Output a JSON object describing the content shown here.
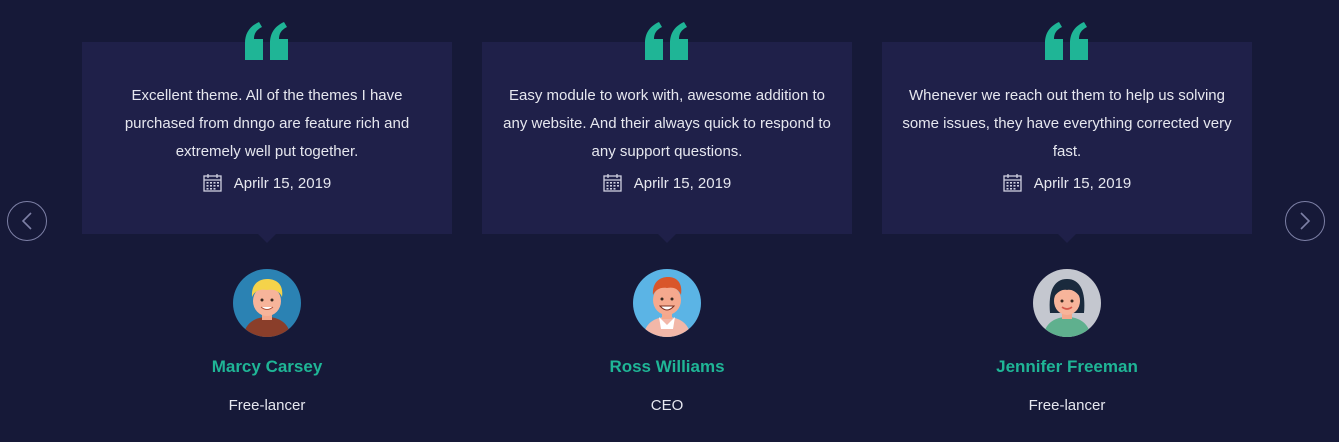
{
  "colors": {
    "background": "#161938",
    "card": "#1f2049",
    "accent": "#1fb596",
    "text": "#e6e7ef"
  },
  "navigation": {
    "prev_icon": "chevron-left-icon",
    "next_icon": "chevron-right-icon"
  },
  "testimonials": [
    {
      "quote": "Excellent theme. All of the themes I have purchased from dnngo are feature rich and extremely well put together.",
      "date": "Aprilr 15, 2019",
      "name": "Marcy Carsey",
      "role": "Free-lancer",
      "avatar": "avatar-blond-man"
    },
    {
      "quote": "Easy module to work with, awesome addition to any website. And their always quick to respond to any support questions.",
      "date": "Aprilr 15, 2019",
      "name": "Ross Williams",
      "role": "CEO",
      "avatar": "avatar-redhead-man"
    },
    {
      "quote": "Whenever we reach out them to help us solving some issues, they have everything corrected very fast.",
      "date": "Aprilr 15, 2019",
      "name": "Jennifer Freeman",
      "role": "Free-lancer",
      "avatar": "avatar-dark-haired-woman"
    }
  ]
}
